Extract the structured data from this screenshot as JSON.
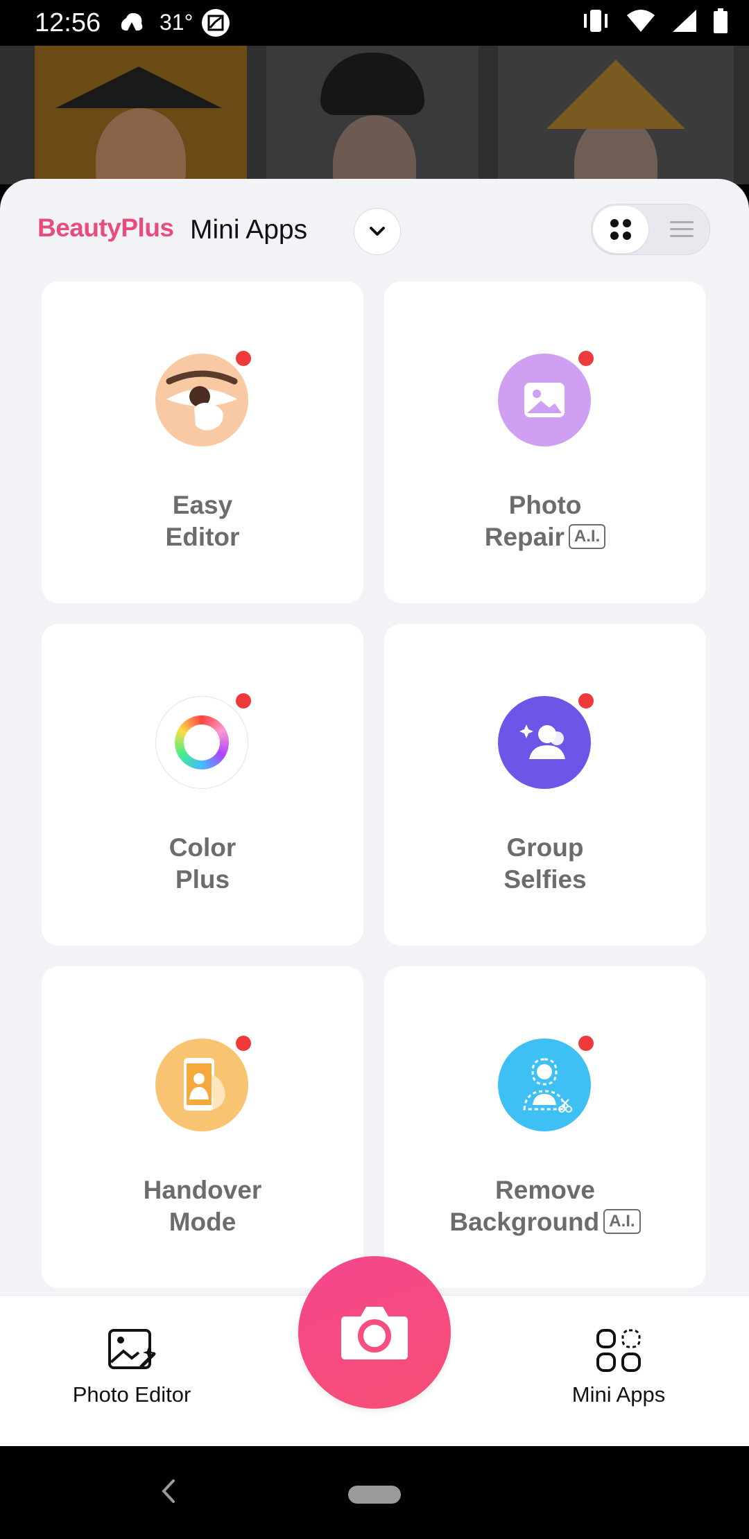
{
  "status_bar": {
    "time": "12:56",
    "temperature": "31°",
    "icons": [
      "weather-icon",
      "image-icon",
      "vibrate-icon",
      "wifi-icon",
      "signal-icon",
      "battery-icon"
    ]
  },
  "header": {
    "brand": "BeautyPlus",
    "title": "Mini Apps",
    "dropdown_icon": "chevron-down-icon",
    "view_grid_icon": "grid-view-icon",
    "view_list_icon": "list-view-icon"
  },
  "apps": [
    {
      "line1": "Easy",
      "line2": "Editor",
      "ai": "",
      "icon": "easy-editor-icon",
      "color": "#f9c9a3",
      "new": true
    },
    {
      "line1": "Photo",
      "line2": "Repair",
      "ai": "A.I.",
      "icon": "photo-repair-icon",
      "color": "#cf9ff2",
      "new": true
    },
    {
      "line1": "Color",
      "line2": "Plus",
      "ai": "",
      "icon": "color-plus-icon",
      "color": "#ffffff",
      "new": true
    },
    {
      "line1": "Group",
      "line2": "Selfies",
      "ai": "",
      "icon": "group-selfies-icon",
      "color": "#6d55e8",
      "new": true
    },
    {
      "line1": "Handover",
      "line2": "Mode",
      "ai": "",
      "icon": "handover-mode-icon",
      "color": "#f9c471",
      "new": true
    },
    {
      "line1": "Remove",
      "line2": "Background",
      "ai": "A.I.",
      "icon": "remove-background-icon",
      "color": "#3fc0f5",
      "new": true
    }
  ],
  "bottom_nav": {
    "photo_editor": "Photo Editor",
    "mini_apps": "Mini Apps",
    "camera_icon": "camera-icon"
  },
  "colors": {
    "brand": "#e94c7c",
    "camera": "#f64f80",
    "badge_dot": "#ee3a3a",
    "sheet_bg": "#f1f3f6"
  }
}
